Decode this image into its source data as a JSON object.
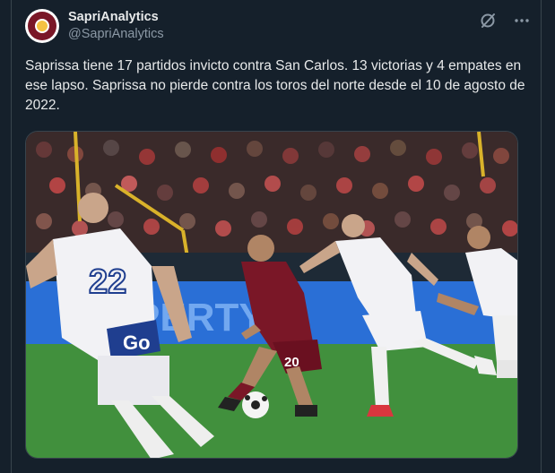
{
  "account": {
    "display_name": "SapriAnalytics",
    "handle": "@SapriAnalytics",
    "avatar_icon": "saprissa-crest-avatar"
  },
  "header_icons": {
    "grok": "grok-slash-circle-icon",
    "more": "more-dots-icon"
  },
  "tweet": {
    "text": "Saprissa tiene 17 partidos invicto contra San Carlos. 13 victorias y 4 empates en ese lapso. Saprissa no pierde contra los toros del norte desde el 10 de agosto de 2022."
  },
  "media": {
    "description_icon": "football-match-photo",
    "jersey_numbers": {
      "left_player": "22",
      "center_player": "20"
    },
    "shirt_sponsor": "Go",
    "ad_board_text": "PERTY"
  },
  "colors": {
    "background": "#15202b",
    "text_primary": "#e7e9ea",
    "text_secondary": "#8b98a5",
    "saprissa_maroon": "#7a1727"
  }
}
